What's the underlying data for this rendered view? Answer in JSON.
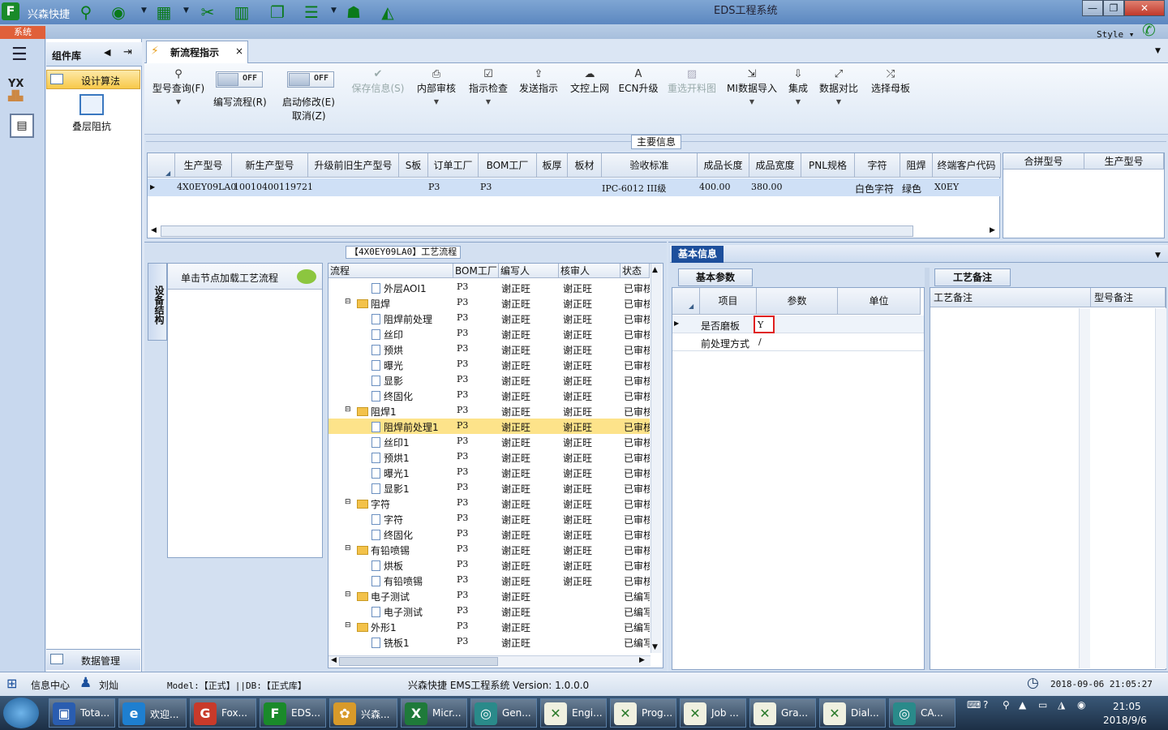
{
  "titlebar": {
    "app_name": "兴森快捷",
    "window_title": "EDS工程系统",
    "min": "—",
    "restore": "❐",
    "close": "✕"
  },
  "topbar": {
    "system_tab": "系统",
    "style_label": "Style ▾"
  },
  "component_panel": {
    "title": "组件库",
    "item_selected": "设计算法",
    "item_icon_label": "叠层阻抗",
    "bottom_item": "数据管理"
  },
  "doc_tab": {
    "label": "新流程指示",
    "close": "×"
  },
  "toolbar": {
    "model_query": "型号查询(F)",
    "edit_flow": "编写流程(R)",
    "toggle_off": "OFF",
    "enable_edit": "启动修改(E)",
    "cancel": "取消(Z)",
    "save_info": "保存信息(S)",
    "internal_review": "内部审核",
    "instruction_check": "指示检查",
    "send_instruction": "发送指示",
    "doc_upload": "文控上网",
    "ecn_upgrade": "ECN升级",
    "reselect_material": "重选开料图",
    "mi_import": "MI数据导入",
    "integrate": "集成",
    "data_compare": "数据对比",
    "select_mother": "选择母板"
  },
  "main_info": {
    "title": "主要信息",
    "columns": [
      "生产型号",
      "新生产型号",
      "升级前旧生产型号",
      "S板",
      "订单工厂",
      "BOM工厂",
      "板厚",
      "板材",
      "验收标准",
      "成品长度",
      "成品宽度",
      "PNL规格",
      "字符",
      "阻焊",
      "终端客户代码"
    ],
    "row": {
      "prod_model": "4X0EY09LA0",
      "new_model": "10010400119721",
      "order_factory": "P3",
      "bom_factory": "P3",
      "standard": "IPC-6012 III级",
      "length": "400.00",
      "width": "380.00",
      "char": "白色字符",
      "solder": "绿色",
      "customer": "X0EY"
    },
    "right_columns": [
      "合拼型号",
      "生产型号"
    ]
  },
  "flow_panel": {
    "title": "【4X0EY09LA0】工艺流程",
    "device_tab": "设备结构",
    "device_hint": "单击节点加载工艺流程",
    "columns": [
      "流程",
      "BOM工厂",
      "编写人",
      "核审人",
      "状态"
    ],
    "rows": [
      {
        "name": "外层AOI1",
        "type": "doc",
        "level": 1,
        "bom": "P3",
        "writer": "谢正旺",
        "reviewer": "谢正旺",
        "status": "已审核"
      },
      {
        "name": "阻焊",
        "type": "folder",
        "level": 0,
        "bom": "P3",
        "writer": "谢正旺",
        "reviewer": "谢正旺",
        "status": "已审核"
      },
      {
        "name": "阻焊前处理",
        "type": "doc",
        "level": 1,
        "bom": "P3",
        "writer": "谢正旺",
        "reviewer": "谢正旺",
        "status": "已审核"
      },
      {
        "name": "丝印",
        "type": "doc",
        "level": 1,
        "bom": "P3",
        "writer": "谢正旺",
        "reviewer": "谢正旺",
        "status": "已审核"
      },
      {
        "name": "预烘",
        "type": "doc",
        "level": 1,
        "bom": "P3",
        "writer": "谢正旺",
        "reviewer": "谢正旺",
        "status": "已审核"
      },
      {
        "name": "曝光",
        "type": "doc",
        "level": 1,
        "bom": "P3",
        "writer": "谢正旺",
        "reviewer": "谢正旺",
        "status": "已审核"
      },
      {
        "name": "显影",
        "type": "doc",
        "level": 1,
        "bom": "P3",
        "writer": "谢正旺",
        "reviewer": "谢正旺",
        "status": "已审核"
      },
      {
        "name": "终固化",
        "type": "doc",
        "level": 1,
        "bom": "P3",
        "writer": "谢正旺",
        "reviewer": "谢正旺",
        "status": "已审核"
      },
      {
        "name": "阻焊1",
        "type": "folder",
        "level": 0,
        "bom": "P3",
        "writer": "谢正旺",
        "reviewer": "谢正旺",
        "status": "已审核"
      },
      {
        "name": "阻焊前处理1",
        "type": "doc",
        "level": 1,
        "bom": "P3",
        "writer": "谢正旺",
        "reviewer": "谢正旺",
        "status": "已审核",
        "selected": true
      },
      {
        "name": "丝印1",
        "type": "doc",
        "level": 1,
        "bom": "P3",
        "writer": "谢正旺",
        "reviewer": "谢正旺",
        "status": "已审核"
      },
      {
        "name": "预烘1",
        "type": "doc",
        "level": 1,
        "bom": "P3",
        "writer": "谢正旺",
        "reviewer": "谢正旺",
        "status": "已审核"
      },
      {
        "name": "曝光1",
        "type": "doc",
        "level": 1,
        "bom": "P3",
        "writer": "谢正旺",
        "reviewer": "谢正旺",
        "status": "已审核"
      },
      {
        "name": "显影1",
        "type": "doc",
        "level": 1,
        "bom": "P3",
        "writer": "谢正旺",
        "reviewer": "谢正旺",
        "status": "已审核"
      },
      {
        "name": "字符",
        "type": "folder",
        "level": 0,
        "bom": "P3",
        "writer": "谢正旺",
        "reviewer": "谢正旺",
        "status": "已审核"
      },
      {
        "name": "字符",
        "type": "doc",
        "level": 1,
        "bom": "P3",
        "writer": "谢正旺",
        "reviewer": "谢正旺",
        "status": "已审核"
      },
      {
        "name": "终固化",
        "type": "doc",
        "level": 1,
        "bom": "P3",
        "writer": "谢正旺",
        "reviewer": "谢正旺",
        "status": "已审核"
      },
      {
        "name": "有铅喷锡",
        "type": "folder",
        "level": 0,
        "bom": "P3",
        "writer": "谢正旺",
        "reviewer": "谢正旺",
        "status": "已审核"
      },
      {
        "name": "烘板",
        "type": "doc",
        "level": 1,
        "bom": "P3",
        "writer": "谢正旺",
        "reviewer": "谢正旺",
        "status": "已审核"
      },
      {
        "name": "有铅喷锡",
        "type": "doc",
        "level": 1,
        "bom": "P3",
        "writer": "谢正旺",
        "reviewer": "谢正旺",
        "status": "已审核"
      },
      {
        "name": "电子测试",
        "type": "folder",
        "level": 0,
        "bom": "P3",
        "writer": "谢正旺",
        "reviewer": "",
        "status": "已编写"
      },
      {
        "name": "电子测试",
        "type": "doc",
        "level": 1,
        "bom": "P3",
        "writer": "谢正旺",
        "reviewer": "",
        "status": "已编写"
      },
      {
        "name": "外形1",
        "type": "folder",
        "level": 0,
        "bom": "P3",
        "writer": "谢正旺",
        "reviewer": "",
        "status": "已编写"
      },
      {
        "name": "铣板1",
        "type": "doc",
        "level": 1,
        "bom": "P3",
        "writer": "谢正旺",
        "reviewer": "",
        "status": "已编写"
      }
    ]
  },
  "basic_info": {
    "tab": "基本信息",
    "param_tab": "基本参数",
    "columns": [
      "项目",
      "参数",
      "单位"
    ],
    "rows": [
      {
        "item": "是否磨板",
        "value": "Y",
        "unit": ""
      },
      {
        "item": "前处理方式",
        "value": "/",
        "unit": ""
      }
    ],
    "note_tab": "工艺备注",
    "note_columns": [
      "工艺备注",
      "型号备注"
    ]
  },
  "statusbar": {
    "info_center": "信息中心",
    "user": "刘灿",
    "model_text": "Model:【正式】||DB:【正式库】",
    "version_text": "兴森快捷 EMS工程系统 Version: 1.0.0.0",
    "datetime": "2018-09-06 21:05:27"
  },
  "taskbar": {
    "items": [
      {
        "label": "Tota...",
        "color": "#2a5db0",
        "glyph": "▣"
      },
      {
        "label": "欢迎...",
        "color": "#1e7fd0",
        "glyph": "e"
      },
      {
        "label": "Fox...",
        "color": "#c83a2a",
        "glyph": "G"
      },
      {
        "label": "EDS...",
        "color": "#1a8a2a",
        "glyph": "F"
      },
      {
        "label": "兴森...",
        "color": "#d89a2a",
        "glyph": "✿"
      },
      {
        "label": "Micr...",
        "color": "#1f7a3a",
        "glyph": "X"
      },
      {
        "label": "Gen...",
        "color": "#2a8a8a",
        "glyph": "◎"
      },
      {
        "label": "Engi...",
        "color": "#f0f0e0",
        "glyph": "✕"
      },
      {
        "label": "Prog...",
        "color": "#f0f0e0",
        "glyph": "✕"
      },
      {
        "label": "Job ...",
        "color": "#f0f0e0",
        "glyph": "✕"
      },
      {
        "label": "Gra...",
        "color": "#f0f0e0",
        "glyph": "✕"
      },
      {
        "label": "Dial...",
        "color": "#f0f0e0",
        "glyph": "✕"
      },
      {
        "label": "CA...",
        "color": "#2a8a8a",
        "glyph": "◎"
      }
    ],
    "clock_time": "21:05",
    "clock_date": "2018/9/6"
  }
}
